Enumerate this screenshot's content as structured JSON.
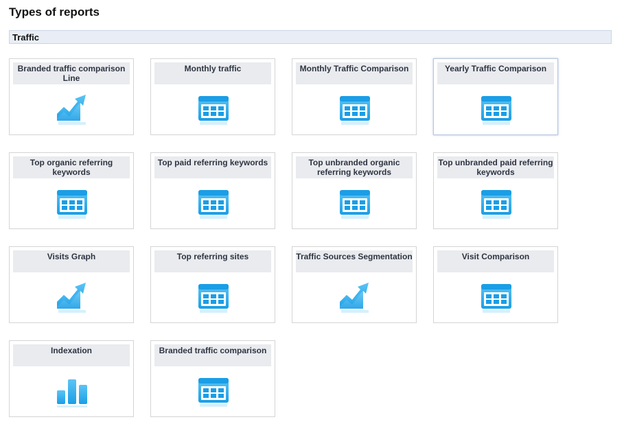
{
  "page": {
    "title": "Types of reports"
  },
  "section": {
    "label": "Traffic"
  },
  "colors": {
    "icon_blue": "#1a9ee6",
    "icon_light": "#5cc4f5",
    "title_bg": "#e9ebef",
    "section_bg": "#e9eef6"
  },
  "reports": [
    {
      "label": "Branded traffic comparison Line",
      "icon": "line-chart-icon"
    },
    {
      "label": "Monthly traffic",
      "icon": "table-icon"
    },
    {
      "label": "Monthly Traffic Comparison",
      "icon": "table-icon"
    },
    {
      "label": "Yearly Traffic Comparison",
      "icon": "table-icon"
    },
    {
      "label": "Top organic referring keywords",
      "icon": "table-icon"
    },
    {
      "label": "Top paid referring keywords",
      "icon": "table-icon"
    },
    {
      "label": "Top unbranded organic referring keywords",
      "icon": "table-icon"
    },
    {
      "label": "Top unbranded paid referring keywords",
      "icon": "table-icon"
    },
    {
      "label": "Visits Graph",
      "icon": "line-chart-icon"
    },
    {
      "label": "Top referring sites",
      "icon": "table-icon"
    },
    {
      "label": "Traffic Sources Segmentation",
      "icon": "line-chart-icon"
    },
    {
      "label": "Visit Comparison",
      "icon": "table-icon"
    },
    {
      "label": "Indexation",
      "icon": "bar-chart-icon"
    },
    {
      "label": "Branded traffic comparison",
      "icon": "table-icon"
    }
  ]
}
